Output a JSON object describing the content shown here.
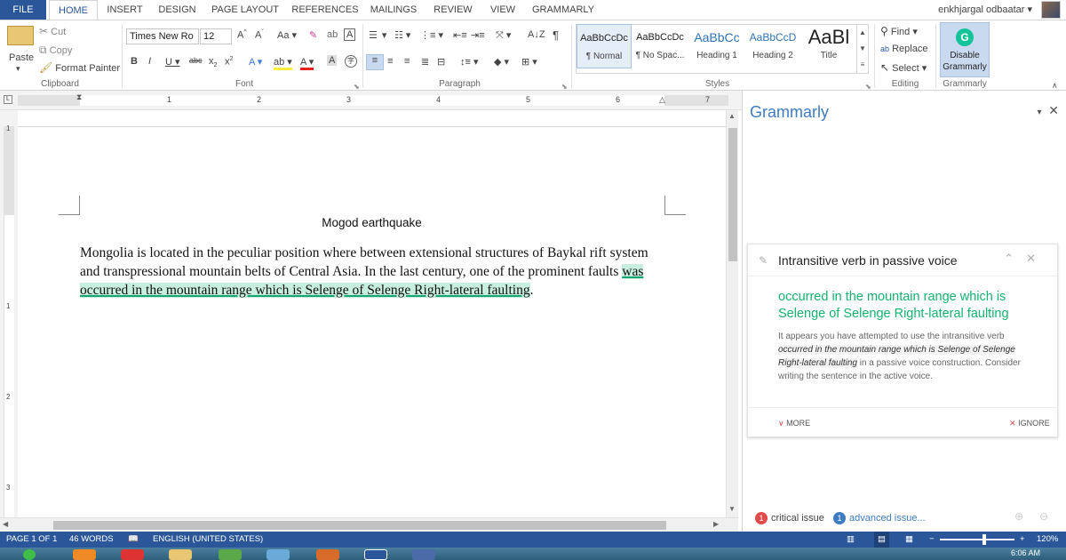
{
  "tabs": [
    "FILE",
    "HOME",
    "INSERT",
    "DESIGN",
    "PAGE LAYOUT",
    "REFERENCES",
    "MAILINGS",
    "REVIEW",
    "VIEW",
    "GRAMMARLY"
  ],
  "user_name": "enkhjargal odbaatar",
  "ribbon": {
    "clipboard": {
      "paste": "Paste",
      "cut": "Cut",
      "copy": "Copy",
      "format_painter": "Format Painter",
      "label": "Clipboard"
    },
    "font": {
      "name": "Times New Ro",
      "size": "12",
      "label": "Font"
    },
    "paragraph": {
      "label": "Paragraph"
    },
    "styles": {
      "items": [
        {
          "sample": "AaBbCcDc",
          "name": "¶ Normal"
        },
        {
          "sample": "AaBbCcDc",
          "name": "¶ No Spac..."
        },
        {
          "sample": "AaBbCc",
          "name": "Heading 1"
        },
        {
          "sample": "AaBbCcD",
          "name": "Heading 2"
        },
        {
          "sample": "AaBl",
          "name": "Title"
        }
      ],
      "label": "Styles"
    },
    "editing": {
      "find": "Find",
      "replace": "Replace",
      "select": "Select",
      "label": "Editing"
    },
    "grammarly": {
      "button": "Disable Grammarly",
      "label": "Grammarly"
    }
  },
  "ruler_numbers": [
    "1",
    "1",
    "2",
    "3",
    "4",
    "5",
    "6",
    "7"
  ],
  "vruler_numbers": [
    "1",
    "1",
    "2",
    "3"
  ],
  "document": {
    "title": "Mogod earthquake",
    "body_before": "Mongolia is located in the peculiar position where between extensional structures of Baykal rift system and transpressional mountain belts of Central Asia. In the last century, one of the prominent faults ",
    "body_highlight": "was occurred in the mountain range which is Selenge of Selenge Right-lateral faulting",
    "body_after": "."
  },
  "pane": {
    "title": "Grammarly",
    "card": {
      "title": "Intransitive verb in passive voice",
      "suggestion": "occurred in the mountain range which is Selenge of Selenge Right-lateral faulting",
      "expl_1": "It appears you have attempted to use the intransitive verb",
      "expl_quote": "occurred in the mountain range which is Selenge of Selenge Right-lateral faulting",
      "expl_2": "in a passive voice construction. Consider writing the sentence in the active voice.",
      "more": "MORE",
      "ignore": "IGNORE"
    },
    "critical_count": "1",
    "critical_label": "critical issue",
    "advanced_count": "1",
    "advanced_label": "advanced issue..."
  },
  "status": {
    "page": "PAGE 1 OF 1",
    "words": "46 WORDS",
    "language": "ENGLISH (UNITED STATES)",
    "zoom": "120%",
    "zoom_level": 0.6
  },
  "taskbar": {
    "time": "6:06 AM"
  },
  "colors": {
    "word_blue": "#2b579a",
    "grammarly_green": "#15c39a",
    "highlight": "#c7eedf",
    "pane_title": "#3e7cc1",
    "badge_red": "#e14b4b",
    "badge_blue": "#3e7cc1"
  }
}
